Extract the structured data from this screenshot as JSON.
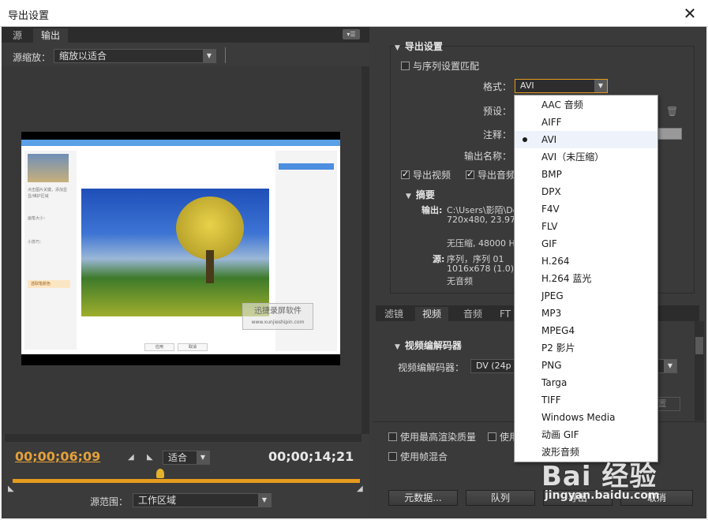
{
  "window": {
    "title": "导出设置",
    "close_glyph": "✕"
  },
  "left": {
    "tabs": [
      "源",
      "输出"
    ],
    "active_tab": "输出",
    "panel_menu_glyph": "▾☰",
    "source_scale_label": "源缩放：",
    "source_scale_value": "缩放以适合",
    "preview": {
      "side_text_1": "点击图片关键，添加显",
      "side_text_2": "显/维护区域",
      "side_text_3": "画笔大小：",
      "side_text_4": "小技巧：",
      "side_btn": "选取笔颜色",
      "watermark_line1": "迅捷录屏软件",
      "watermark_line2": "www.xunjieshipin.com",
      "btn_ok": "应用",
      "btn_cancel": "取消"
    },
    "current_time": "00;00;06;09",
    "end_time": "00;00;14;21",
    "fit_value": "适合",
    "source_range_label": "源范围：",
    "source_range_value": "工作区域"
  },
  "right": {
    "export_settings_title": "导出设置",
    "match_sequence_label": "与序列设置匹配",
    "format_label": "格式：",
    "format_value": "AVI",
    "preset_label": "预设：",
    "comments_label": "注释：",
    "output_name_label": "输出名称：",
    "export_video_label": "导出视频",
    "export_audio_label": "导出音频",
    "summary_title": "摘要",
    "output_key": "输出:",
    "output_line1": "C:\\Users\\影陌\\De",
    "output_line2": "720x480, 23.976",
    "output_line3": "无压缩, 48000 H",
    "source_key": "源:",
    "source_line1": "序列，序列 01",
    "source_line2": "1016x678 (1.0), 1",
    "source_line3": "无音频",
    "tabs": [
      "滤镜",
      "视频",
      "音频",
      "FT"
    ],
    "active_tab": "视频",
    "video_codec_section": "视频编解码器",
    "video_codec_label": "视频编解码器：",
    "video_codec_value": "DV (24p Ac",
    "ghost_button": "置",
    "max_render_label": "使用最高渲染质量",
    "use_preview_label": "使用",
    "frame_blend_label": "使用帧混合",
    "metadata_button": "元数据...",
    "queue_button": "队列",
    "export_button": "导出",
    "cancel_button": "取消"
  },
  "format_dropdown": {
    "selected": "AVI",
    "items": [
      "AAC 音频",
      "AIFF",
      "AVI",
      "AVI（未压缩）",
      "BMP",
      "DPX",
      "F4V",
      "FLV",
      "GIF",
      "H.264",
      "H.264 蓝光",
      "JPEG",
      "MP3",
      "MPEG4",
      "P2 影片",
      "PNG",
      "Targa",
      "TIFF",
      "Windows Media",
      "动画 GIF",
      "波形音频"
    ]
  },
  "watermark": {
    "logo": "Bai 经验",
    "url": "jingyan.baidu.com"
  },
  "colors": {
    "accent": "#e59b1c",
    "panel": "#3a3a3a",
    "timecode": "#e3a03a"
  }
}
